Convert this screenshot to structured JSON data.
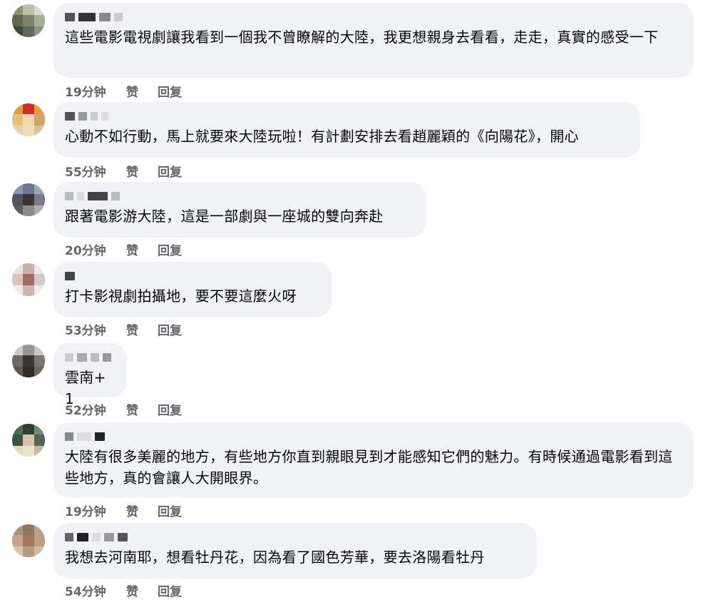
{
  "comments": [
    {
      "text": "這些電影電視劇讓我看到一個我不曾瞭解的大陸，我更想親身去看看，走走，真實的感受一下",
      "time": "19分钟",
      "like": "赞",
      "reply": "回复"
    },
    {
      "text": "心動不如行動，馬上就要來大陸玩啦！有計劃安排去看趙麗穎的《向陽花》，開心",
      "time": "55分钟",
      "like": "赞",
      "reply": "回复"
    },
    {
      "text": "跟著電影游大陸，這是一部劇與一座城的雙向奔赴",
      "time": "20分钟",
      "like": "赞",
      "reply": "回复"
    },
    {
      "text": "打卡影視劇拍攝地，要不要這麼火呀",
      "time": "53分钟",
      "like": "赞",
      "reply": "回复"
    },
    {
      "text": "雲南+1",
      "time": "52分钟",
      "like": "赞",
      "reply": "回复"
    },
    {
      "text": "大陸有很多美麗的地方，有些地方你直到親眼見到才能感知它們的魅力。有時候通過電影看到這些地方，真的會讓人大開眼界。",
      "time": "19分钟",
      "like": "赞",
      "reply": "回复"
    },
    {
      "text": "我想去河南耶，想看牡丹花，因為看了國色芳華，要去洛陽看牡丹",
      "time": "54分钟",
      "like": "赞",
      "reply": "回复"
    }
  ],
  "colors": {
    "bubble": "#f0f2f5",
    "text": "#050505",
    "meta": "#65676b"
  }
}
